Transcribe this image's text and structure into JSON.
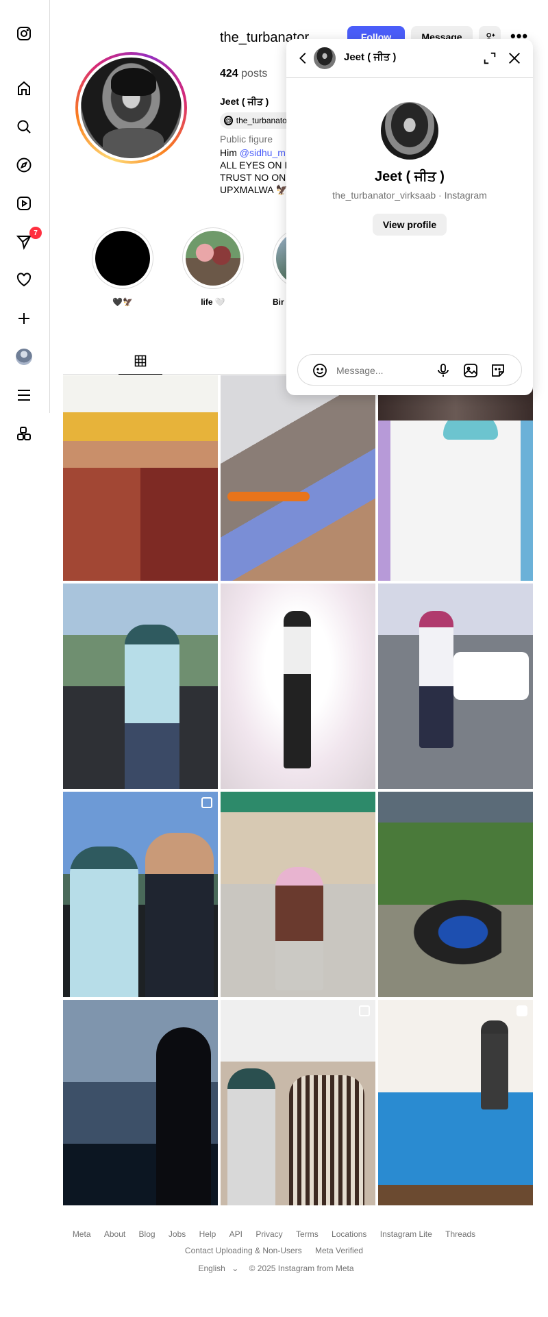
{
  "profile": {
    "username": "the_turbanator",
    "follow_label": "Follow",
    "message_label": "Message",
    "posts_count": "424",
    "posts_label": "posts",
    "display_name": "Jeet ( ਜੀਤ )",
    "threads_handle": "the_turbanator_virksaab",
    "category": "Public figure",
    "bio": {
      "line1_prefix": "Him ",
      "line1_link": "@sidhu_m",
      "line2": "ALL EYES ON I",
      "line3": "TRUST NO ON",
      "line4": "UPXMALWA 🦅"
    }
  },
  "highlights": [
    {
      "label": "🖤🦅"
    },
    {
      "label": "life 🤍"
    },
    {
      "label": "Bir"
    }
  ],
  "footer": {
    "links": [
      "Meta",
      "About",
      "Blog",
      "Jobs",
      "Help",
      "API",
      "Privacy",
      "Terms",
      "Locations",
      "Instagram Lite",
      "Threads",
      "Contact Uploading & Non-Users",
      "Meta Verified"
    ],
    "language": "English",
    "copyright": "© 2025 Instagram from Meta"
  },
  "notifications_badge": "7",
  "chat": {
    "name": "Jeet ( ਜੀਤ )",
    "big_name": "Jeet ( ਜੀਤ )",
    "handle_line": "the_turbanator_virksaab · Instagram",
    "view_profile_label": "View profile",
    "message_placeholder": "Message..."
  },
  "icons": {
    "sidebar": [
      "instagram-logo-icon",
      "home-icon",
      "search-icon",
      "explore-icon",
      "reels-icon",
      "messages-icon",
      "notifications-icon",
      "create-icon",
      "profile-avatar",
      "menu-icon",
      "also-from-meta-icon"
    ]
  },
  "colors": {
    "follow_button": "#4a5df9",
    "secondary_button": "#efefef",
    "badge": "#ff3040",
    "link": "#4a5df9"
  }
}
